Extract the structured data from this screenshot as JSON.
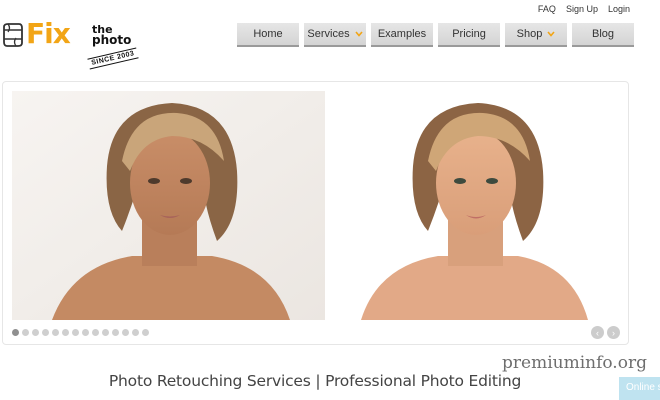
{
  "toplinks": {
    "faq": "FAQ",
    "signup": "Sign Up",
    "login": "Login"
  },
  "logo": {
    "fix": "Fix",
    "the": "the",
    "photo": "photo",
    "since": "SINCE 2003",
    "accent": "#f2a516"
  },
  "nav": {
    "home": "Home",
    "services": "Services",
    "examples": "Examples",
    "pricing": "Pricing",
    "shop": "Shop",
    "blog": "Blog",
    "chevron_color": "#f2a516"
  },
  "slider": {
    "before_image": "woman-portrait-before-retouch",
    "after_image": "woman-portrait-after-retouch",
    "dot_count": 14,
    "active_dot": 1,
    "prev_icon": "chevron-left-icon",
    "next_icon": "chevron-right-icon"
  },
  "headline": "Photo Retouching Services | Professional Photo Editing",
  "watermark": "premiuminfo.org",
  "online_chat": "Online s"
}
